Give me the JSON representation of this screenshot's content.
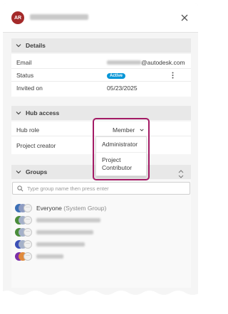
{
  "header": {
    "avatar_initials": "AR"
  },
  "details": {
    "title": "Details",
    "email_label": "Email",
    "email_domain": "@autodesk.com",
    "status_label": "Status",
    "status_value": "Active",
    "invited_label": "Invited on",
    "invited_value": "05/23/2025"
  },
  "hub_access": {
    "title": "Hub access",
    "role_label": "Hub role",
    "role_value": "Member",
    "creator_label": "Project creator",
    "options": [
      "Administrator",
      "Project Contributor"
    ]
  },
  "groups": {
    "title": "Groups",
    "search_placeholder": "Type group name then press enter",
    "items": [
      {
        "name": "Everyone",
        "sub": "(System Group)"
      }
    ]
  },
  "colors": {
    "accent_badge": "#0696d7",
    "highlight": "#a31a65",
    "avatar": "#a42a2a"
  }
}
